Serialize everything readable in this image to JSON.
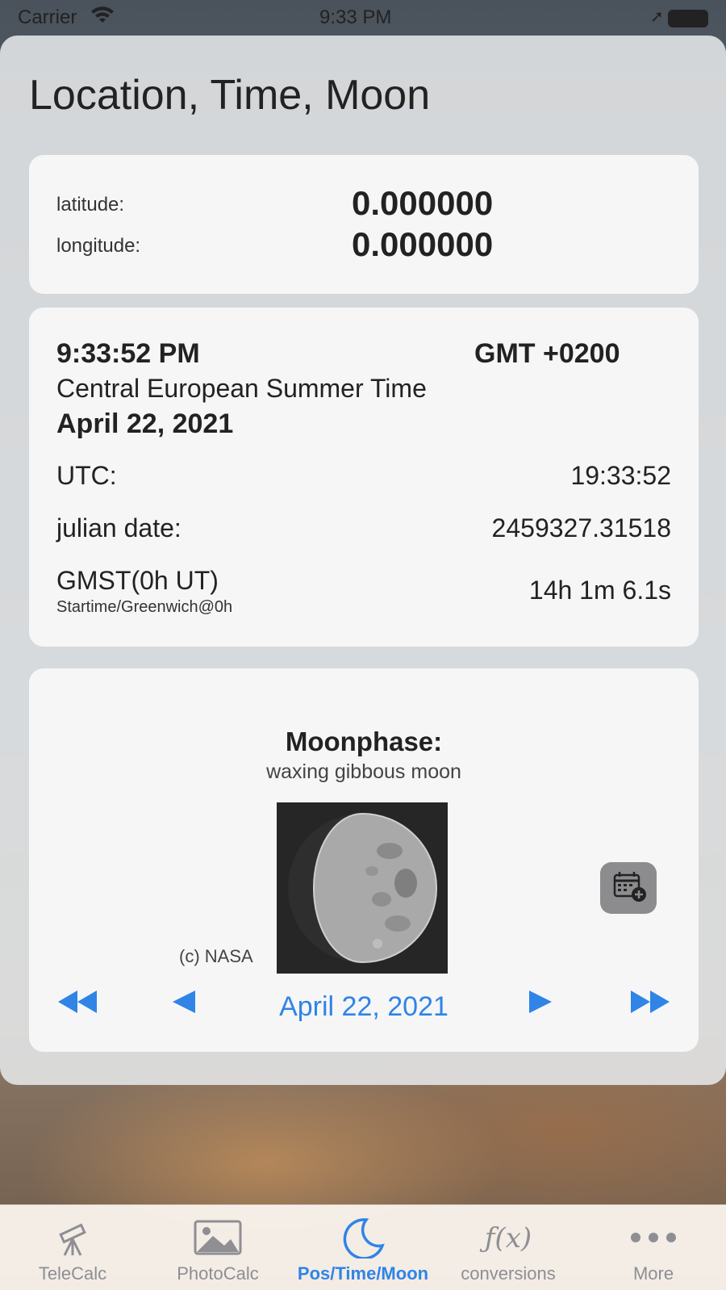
{
  "status_bar": {
    "carrier": "Carrier",
    "time": "9:33 PM"
  },
  "page": {
    "title": "Location, Time, Moon"
  },
  "location": {
    "latitude_label": "latitude:",
    "latitude_value": "0.000000",
    "longitude_label": "longitude:",
    "longitude_value": "0.000000"
  },
  "time": {
    "local_time": "9:33:52 PM",
    "gmt_offset": "GMT +0200",
    "timezone_name": "Central European Summer Time",
    "date": "April 22, 2021",
    "utc_label": "UTC:",
    "utc_value": "19:33:52",
    "julian_label": "julian date:",
    "julian_value": "2459327.31518",
    "gmst_label": "GMST(0h UT)",
    "gmst_sub": "Startime/Greenwich@0h",
    "gmst_value": "14h 1m 6.1s"
  },
  "moon": {
    "title": "Moonphase:",
    "phase": "waxing gibbous moon",
    "credit": "(c) NASA",
    "nav_date": "April 22, 2021",
    "calendar_icon": "calendar-add-icon"
  },
  "tabs": [
    {
      "label": "TeleCalc",
      "icon": "telescope-icon",
      "active": false
    },
    {
      "label": "PhotoCalc",
      "icon": "photo-icon",
      "active": false
    },
    {
      "label": "Pos/Time/Moon",
      "icon": "moon-icon",
      "active": true
    },
    {
      "label": "conversions",
      "icon": "function-icon",
      "active": false
    },
    {
      "label": "More",
      "icon": "more-icon",
      "active": false
    }
  ],
  "colors": {
    "accent": "#2f84e6",
    "inactive_tab": "#8e8e93"
  }
}
